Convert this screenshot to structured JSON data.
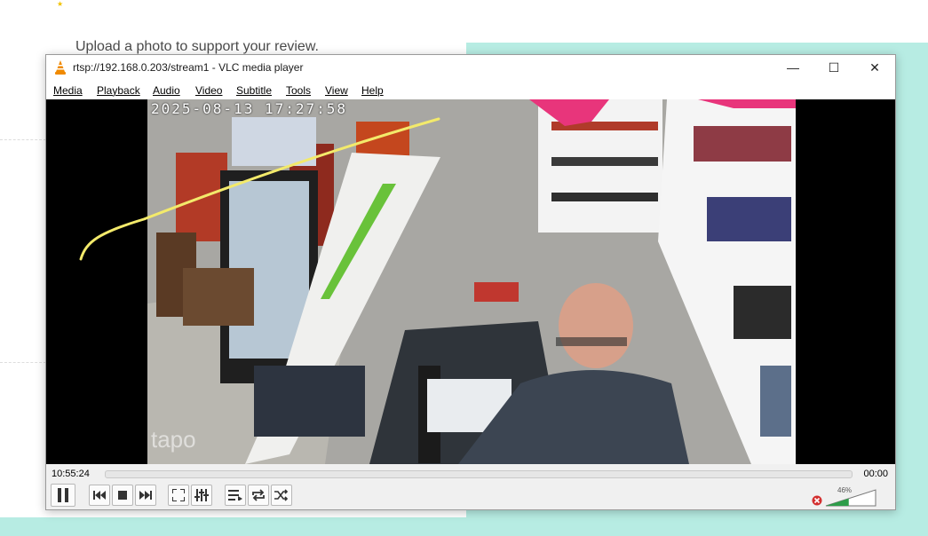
{
  "background_page": {
    "upload_text": "Upload a photo to support your review."
  },
  "window": {
    "title": "rtsp://192.168.0.203/stream1 - VLC media player",
    "min_symbol": "—",
    "max_symbol": "☐",
    "close_symbol": "✕"
  },
  "menu": [
    {
      "label": "Media"
    },
    {
      "label": "Playback"
    },
    {
      "label": "Audio"
    },
    {
      "label": "Video"
    },
    {
      "label": "Subtitle"
    },
    {
      "label": "Tools"
    },
    {
      "label": "View"
    },
    {
      "label": "Help"
    }
  ],
  "video": {
    "timestamp_overlay": "2025-08-13  17:27:58",
    "watermark": "tapo"
  },
  "controls": {
    "elapsed": "10:55:24",
    "total": "00:00",
    "volume_percent": "46%",
    "volume_level": 0.46
  },
  "icons": {
    "pause": "pause-icon",
    "previous": "previous-icon",
    "stop": "stop-icon",
    "next": "next-icon",
    "fullscreen": "fullscreen-icon",
    "extended": "equalizer-icon",
    "playlist": "playlist-icon",
    "loop": "loop-icon",
    "random": "shuffle-icon",
    "mute": "mute-icon"
  },
  "colors": {
    "vlc_orange": "#f08a00",
    "scribble": "#f3ea6b",
    "background_teal": "#b7ece3"
  }
}
